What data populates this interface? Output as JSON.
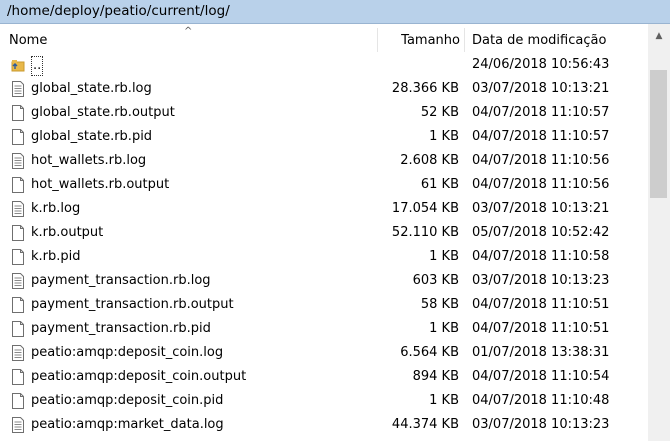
{
  "path": "/home/deploy/peatio/current/log/",
  "columns": {
    "name": "Nome",
    "size": "Tamanho",
    "date": "Data de modificação"
  },
  "files": [
    {
      "name": "..",
      "size": "",
      "date": "24/06/2018 10:56:43",
      "icon": "parent-folder-icon"
    },
    {
      "name": "global_state.rb.log",
      "size": "28.366 KB",
      "date": "03/07/2018 10:13:21",
      "icon": "text-file-icon"
    },
    {
      "name": "global_state.rb.output",
      "size": "52 KB",
      "date": "04/07/2018 11:10:57",
      "icon": "blank-file-icon"
    },
    {
      "name": "global_state.rb.pid",
      "size": "1 KB",
      "date": "04/07/2018 11:10:57",
      "icon": "blank-file-icon"
    },
    {
      "name": "hot_wallets.rb.log",
      "size": "2.608 KB",
      "date": "04/07/2018 11:10:56",
      "icon": "text-file-icon"
    },
    {
      "name": "hot_wallets.rb.output",
      "size": "61 KB",
      "date": "04/07/2018 11:10:56",
      "icon": "blank-file-icon"
    },
    {
      "name": "k.rb.log",
      "size": "17.054 KB",
      "date": "03/07/2018 10:13:21",
      "icon": "text-file-icon"
    },
    {
      "name": "k.rb.output",
      "size": "52.110 KB",
      "date": "05/07/2018 10:52:42",
      "icon": "blank-file-icon"
    },
    {
      "name": "k.rb.pid",
      "size": "1 KB",
      "date": "04/07/2018 11:10:58",
      "icon": "blank-file-icon"
    },
    {
      "name": "payment_transaction.rb.log",
      "size": "603 KB",
      "date": "03/07/2018 10:13:23",
      "icon": "text-file-icon"
    },
    {
      "name": "payment_transaction.rb.output",
      "size": "58 KB",
      "date": "04/07/2018 11:10:51",
      "icon": "blank-file-icon"
    },
    {
      "name": "payment_transaction.rb.pid",
      "size": "1 KB",
      "date": "04/07/2018 11:10:51",
      "icon": "blank-file-icon"
    },
    {
      "name": "peatio:amqp:deposit_coin.log",
      "size": "6.564 KB",
      "date": "01/07/2018 13:38:31",
      "icon": "text-file-icon"
    },
    {
      "name": "peatio:amqp:deposit_coin.output",
      "size": "894 KB",
      "date": "04/07/2018 11:10:54",
      "icon": "blank-file-icon"
    },
    {
      "name": "peatio:amqp:deposit_coin.pid",
      "size": "1 KB",
      "date": "04/07/2018 11:10:48",
      "icon": "blank-file-icon"
    },
    {
      "name": "peatio:amqp:market_data.log",
      "size": "44.374 KB",
      "date": "03/07/2018 10:13:23",
      "icon": "text-file-icon"
    }
  ],
  "colors": {
    "pathbar_bg": "#b9d1ea",
    "scroll_thumb": "#cdcdcd",
    "folder_yellow": "#e8b84a"
  }
}
